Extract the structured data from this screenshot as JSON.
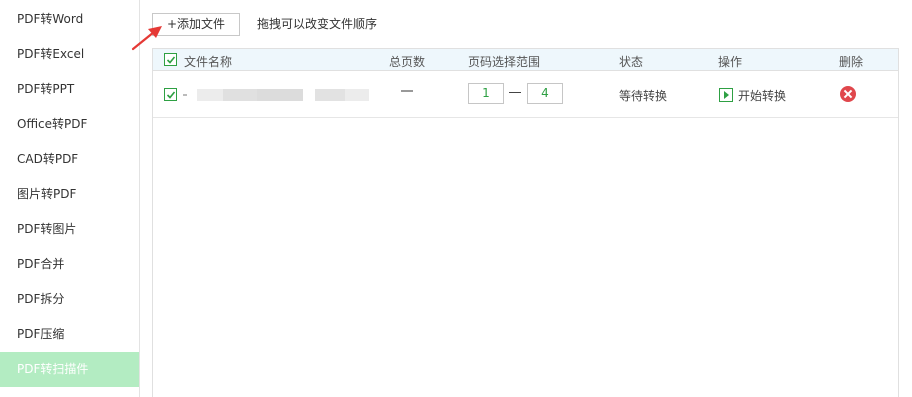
{
  "sidebar": {
    "items": [
      {
        "label": "PDF转Word"
      },
      {
        "label": "PDF转Excel"
      },
      {
        "label": "PDF转PPT"
      },
      {
        "label": "Office转PDF"
      },
      {
        "label": "CAD转PDF"
      },
      {
        "label": "图片转PDF"
      },
      {
        "label": "PDF转图片"
      },
      {
        "label": "PDF合并"
      },
      {
        "label": "PDF拆分"
      },
      {
        "label": "PDF压缩"
      },
      {
        "label": "PDF转扫描件",
        "active": true
      }
    ]
  },
  "toolbar": {
    "add_file_label": "+添加文件",
    "hint": "拖拽可以改变文件顺序"
  },
  "table": {
    "headers": {
      "name": "文件名称",
      "total_pages": "总页数",
      "page_range": "页码选择范围",
      "status": "状态",
      "action": "操作",
      "delete": "删除"
    },
    "rows": [
      {
        "name": "",
        "total_pages": "",
        "page_from": "1",
        "page_to": "4",
        "status": "等待转换",
        "action": "开始转换"
      }
    ]
  },
  "colors": {
    "accent_green": "#2ea043",
    "active_sidebar_bg": "#b3ecc2",
    "header_bg": "#eef7fc",
    "delete_red": "#e0474c",
    "arrow_red": "#e53935"
  }
}
